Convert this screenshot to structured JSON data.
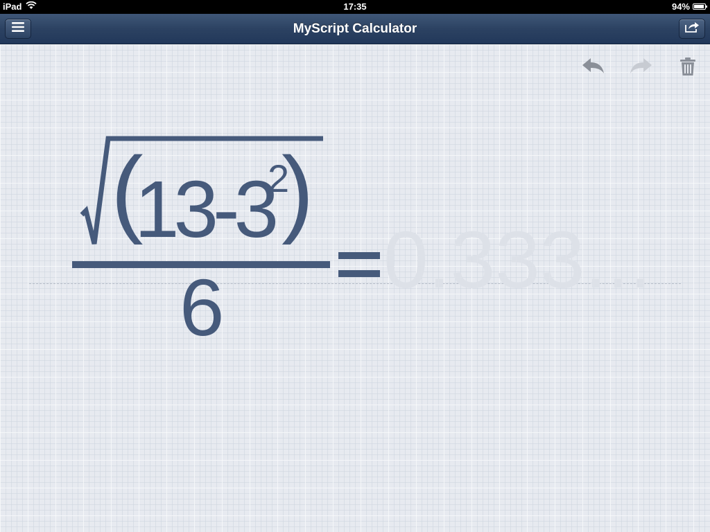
{
  "status_bar": {
    "device": "iPad",
    "time": "17:35",
    "battery": "94%",
    "battery_level": 0.94
  },
  "nav": {
    "title": "MyScript Calculator",
    "left_icon": "menu-icon",
    "right_icon": "share-icon"
  },
  "toolbar": {
    "undo_icon": "undo-icon",
    "redo_icon": "redo-icon",
    "trash_icon": "trash-icon"
  },
  "expression": {
    "open_paren": "(",
    "radicand": "13-3",
    "exponent": "2",
    "close_paren": ")",
    "denominator": "6",
    "equals": "=",
    "result": "0.333..."
  },
  "colors": {
    "ink": "#465a7b",
    "result_ghost": "#dde1e8",
    "navbar": "#2c4262"
  }
}
